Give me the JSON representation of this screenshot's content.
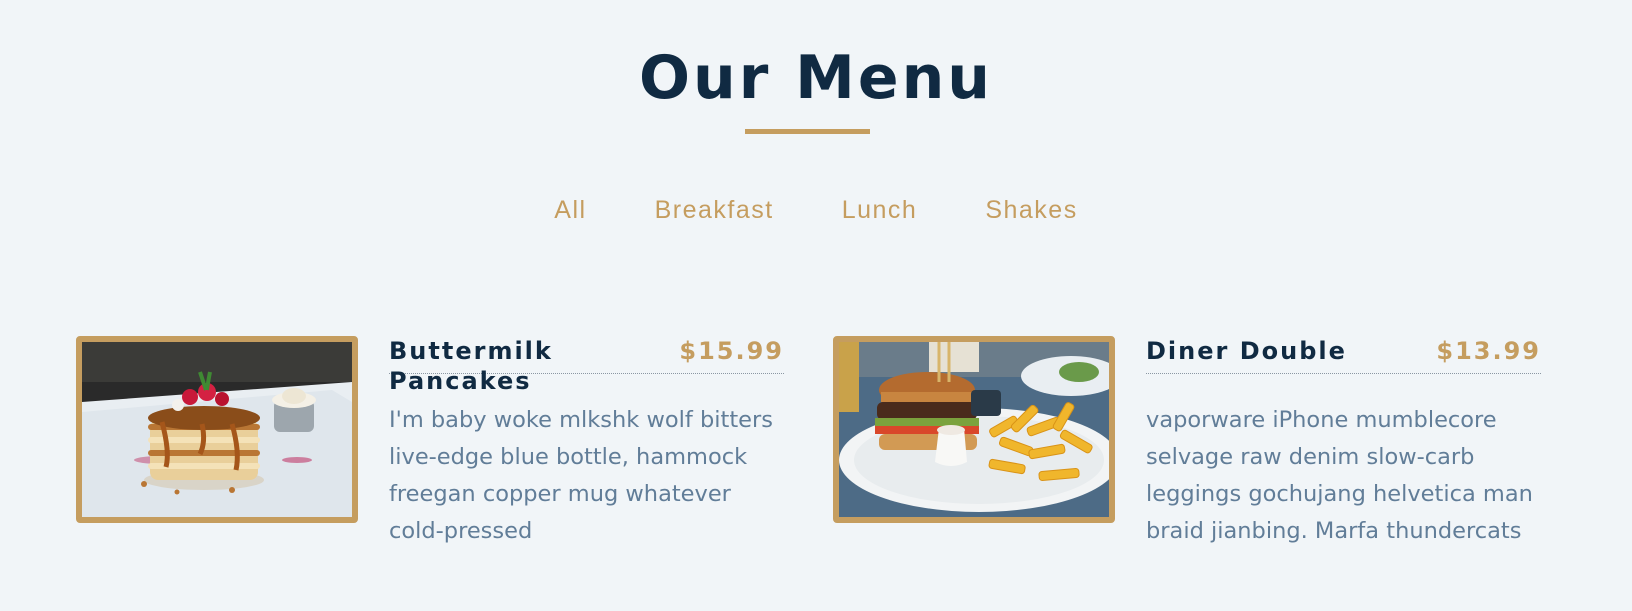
{
  "section": {
    "title": "Our Menu"
  },
  "filters": [
    "All",
    "Breakfast",
    "Lunch",
    "Shakes"
  ],
  "items": [
    {
      "name": "Buttermilk Pancakes",
      "price": "$15.99",
      "description": "I'm baby woke mlkshk wolf bitters live-edge blue bottle, hammock freegan copper mug whatever cold-pressed",
      "image": "pancakes-photo"
    },
    {
      "name": "Diner Double",
      "price": "$13.99",
      "description": "vaporware iPhone mumblecore selvage raw denim slow-carb leggings gochujang helvetica man braid jianbing. Marfa thundercats",
      "image": "burger-photo"
    }
  ],
  "colors": {
    "background": "#f1f5f8",
    "primary": "#102a42",
    "accent": "#c59d5f",
    "text": "#617d98"
  }
}
